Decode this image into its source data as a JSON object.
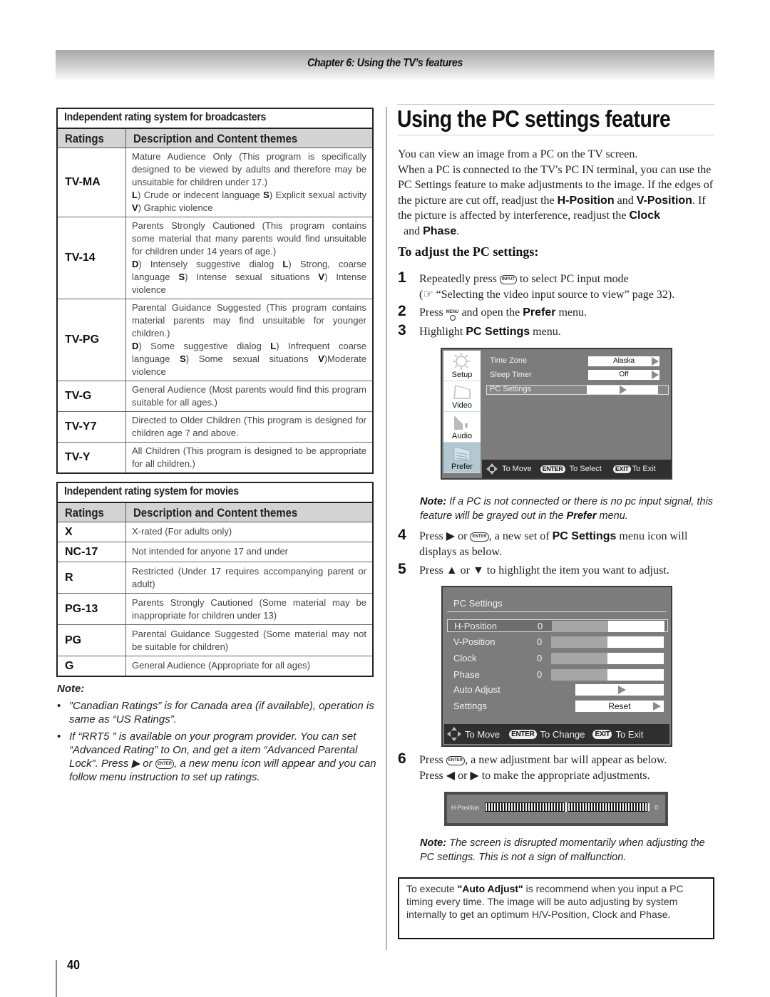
{
  "header": {
    "chapter_title": "Chapter 6: Using the TV’s features"
  },
  "broadcast_table": {
    "caption": "Independent rating system for broadcasters",
    "headers": [
      "Ratings",
      "Description and Content themes"
    ],
    "rows": [
      {
        "rating": "TV-MA",
        "desc": "Mature Audience Only (This program is specifically designed to be viewed by adults and therefore may be unsuitable for children under 17.)",
        "themes": [
          [
            "L",
            ") Crude or indecent language "
          ],
          [
            "S",
            ") Explicit sexual activity "
          ],
          [
            "V",
            ") Graphic violence"
          ]
        ]
      },
      {
        "rating": "TV-14",
        "desc": "Parents Strongly Cautioned (This program contains some material that many parents would find unsuitable for children under 14 years of age.)",
        "themes": [
          [
            "D",
            ") Intensely suggestive dialog "
          ],
          [
            "L",
            ") Strong, coarse language "
          ],
          [
            "S",
            ") Intense sexual situations "
          ],
          [
            "V",
            ") Intense violence"
          ]
        ]
      },
      {
        "rating": "TV-PG",
        "desc": "Parental Guidance Suggested (This program contains material parents may find unsuitable for younger children.)",
        "themes": [
          [
            "D",
            ") Some suggestive dialog "
          ],
          [
            "L",
            ") Infrequent coarse language "
          ],
          [
            "S",
            ") Some sexual situations "
          ],
          [
            "V",
            ")Moderate violence"
          ]
        ]
      },
      {
        "rating": "TV-G",
        "desc": "General Audience (Most parents would find this program suitable for all ages.)",
        "themes": []
      },
      {
        "rating": "TV-Y7",
        "desc": "Directed to Older Children (This program is designed for children age 7 and above.",
        "themes": []
      },
      {
        "rating": "TV-Y",
        "desc": "All Children (This program is designed to be appropriate for all children.)",
        "themes": []
      }
    ]
  },
  "movies_table": {
    "caption": "Independent rating system for movies",
    "headers": [
      "Ratings",
      "Description and Content themes"
    ],
    "rows": [
      {
        "rating": "X",
        "desc": "X-rated (For adults only)"
      },
      {
        "rating": "NC-17",
        "desc": "Not intended for anyone 17 and under"
      },
      {
        "rating": "R",
        "desc": "Restricted (Under 17 requires accompanying parent or adult)"
      },
      {
        "rating": "PG-13",
        "desc": "Parents Strongly Cautioned (Some material may be inappropriate for children under 13)"
      },
      {
        "rating": "PG",
        "desc": "Parental Guidance Suggested (Some material may not be suitable for children)"
      },
      {
        "rating": "G",
        "desc": "General Audience (Appropriate for all ages)"
      }
    ]
  },
  "left_note": {
    "label": "Note:",
    "items": [
      "”Canadian Ratings” is for Canada area (if available), operation is same as “US Ratings”.",
      {
        "before": "If “RRT5 ” is available on your program provider. You can set “Advanced Rating” to On, and get a item “Advanced Parental Lock”. Press ▶ or ",
        "glyph": "ENTER",
        "after": ", a new menu icon will appear and you can follow menu instruction to set up ratings."
      }
    ]
  },
  "page_number": "40",
  "main": {
    "title": "Using the PC settings feature",
    "intro": {
      "p1": "You can view an image from a PC on the TV screen.",
      "p2a": "When a PC is connected to the TV's PC IN terminal, you can use the PC Settings feature to make adjustments to the image. If the edges of the picture are cut off, readjust the ",
      "h_position": "H-Position",
      "p2b": " and ",
      "v_position": "V-Position",
      "p2c": ". If the picture is affected by interference, readjust the ",
      "clock": "Clock",
      "p2d": "  and ",
      "phase": "Phase",
      "p2e": "."
    },
    "subhead": "To adjust the PC settings:",
    "steps": {
      "s1": {
        "num": "1",
        "a": "Repeatedly press ",
        "glyph": "INPUT",
        "b": " to select PC input mode",
        "ref": "(☞ “Selecting the video input source to view” page 32)."
      },
      "s2": {
        "num": "2",
        "a": "Press ",
        "glyph": "MENU",
        "b": " and open the ",
        "bold": "Prefer",
        "c": " menu."
      },
      "s3": {
        "num": "3",
        "a": "Highlight ",
        "bold": "PC Settings",
        "c": " menu."
      },
      "s4": {
        "num": "4",
        "a": "Press ▶ or ",
        "glyph": "ENTER",
        "b": ", a new set of ",
        "bold": "PC Settings",
        "c": " menu icon will displays as below."
      },
      "s5": {
        "num": "5",
        "a": "Press ▲ or ▼ to highlight the item you want to adjust."
      },
      "s6": {
        "num": "6",
        "a": "Press ",
        "glyph": "ENTER",
        "b": ", a new adjustment bar will appear as below.",
        "line2": "Press ◀ or ▶ to make the appropriate adjustments."
      }
    },
    "note1": {
      "label": "Note:",
      "a": " If a PC is not connected or there is no pc input signal, this feature will be grayed out in the ",
      "bold": "Prefer",
      "b": " menu."
    },
    "note2": {
      "label": "Note:",
      "a": " The screen is disrupted momentarily when adjusting the PC settings. This is not a sign of malfunction."
    },
    "info_box": {
      "a": "To execute ",
      "bold": "\"Auto Adjust\"",
      "b": " is recommend when you input a PC timing every time. The image will be auto adjusting by system internally to get an optimum H/V-Position, Clock and Phase."
    }
  },
  "prefer_menu": {
    "tabs": [
      "Setup",
      "Video",
      "Audio",
      "Prefer"
    ],
    "active_tab": "Prefer",
    "items": [
      {
        "label": "Time Zone",
        "value": "Alaska"
      },
      {
        "label": "Sleep Timer",
        "value": "Off"
      },
      {
        "label": "PC Settings",
        "value": ""
      }
    ],
    "footer": {
      "move": "To Move",
      "enter_key": "ENTER",
      "select": "To Select",
      "exit_key": "EXIT",
      "exit": "To Exit"
    }
  },
  "pc_settings_menu": {
    "title": "PC Settings",
    "sliders": [
      {
        "label": "H-Position",
        "value": "0",
        "fill": 0.5
      },
      {
        "label": "V-Position",
        "value": "0",
        "fill": 0.5
      },
      {
        "label": "Clock",
        "value": "0",
        "fill": 0.5
      },
      {
        "label": "Phase",
        "value": "0",
        "fill": 0.5
      }
    ],
    "auto_adjust": {
      "label": "Auto Adjust",
      "value": ""
    },
    "settings": {
      "label": "Settings",
      "value": "Reset"
    },
    "footer": {
      "move": "To Move",
      "enter_key": "ENTER",
      "change": "To Change",
      "exit_key": "EXIT",
      "exit": "To Exit"
    }
  },
  "adjustment_bar": {
    "label": "H-Position",
    "value": "0",
    "position": 0.5
  }
}
